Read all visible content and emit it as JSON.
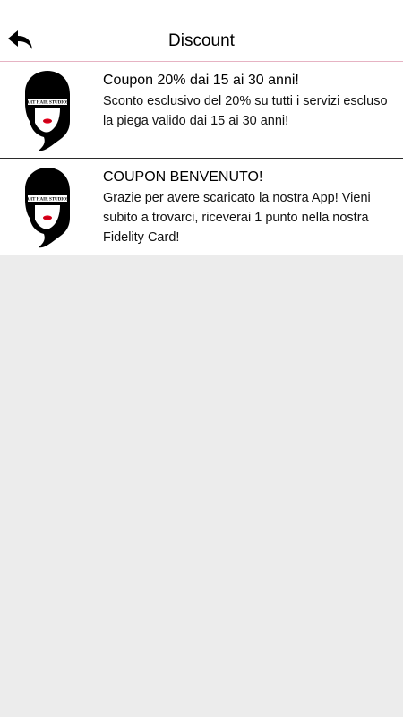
{
  "header": {
    "title": "Discount",
    "back_icon": "back-arrow-icon"
  },
  "colors": {
    "background": "#ececec",
    "card": "#ffffff",
    "header_divider": "#e6b3c3",
    "row_divider": "#2b2b2b",
    "logo_lips": "#e3001b"
  },
  "coupons": [
    {
      "logo_text": "ART HAIR STUDIOS",
      "title": "Coupon 20% dai 15 ai 30 anni!",
      "body": "Sconto esclusivo del 20% su tutti i servizi escluso la piega valido dai 15 ai 30 anni!"
    },
    {
      "logo_text": "ART HAIR STUDIOS",
      "title": "COUPON BENVENUTO!",
      "body": "Grazie per avere scaricato la nostra App! Vieni subito a trovarci, riceverai 1 punto nella nostra Fidelity Card!"
    }
  ]
}
